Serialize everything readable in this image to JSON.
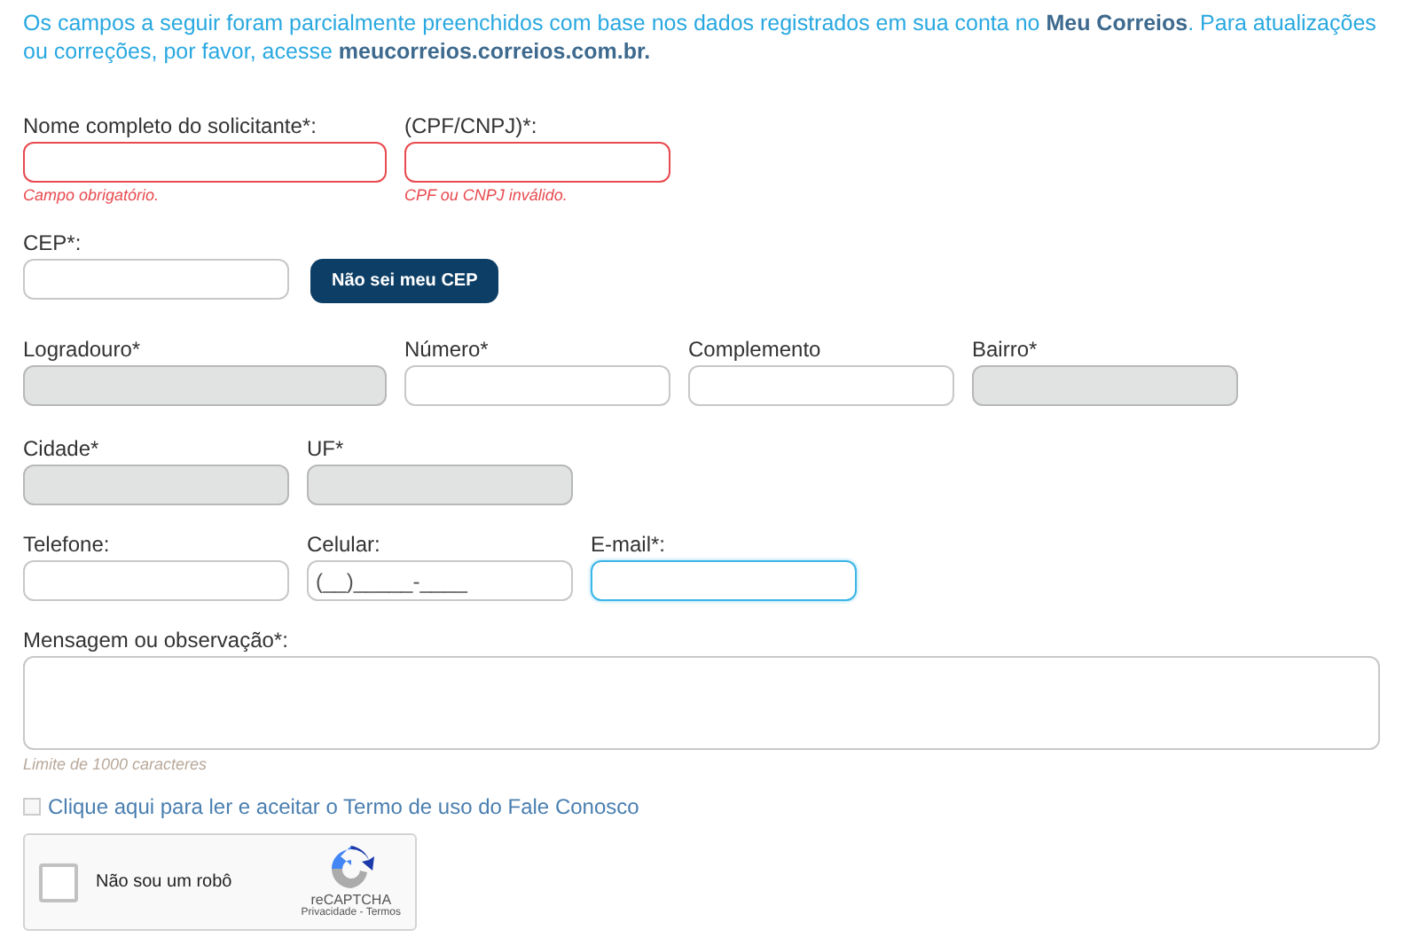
{
  "intro": "Os campos a seguir foram parcialmente preenchidos com base nos dados registrados em sua conta no **Meu Correios**. Para atualizações ou correções, por favor, acesse **meucorreios.correios.com.br.**",
  "rows": [
    {
      "fields": [
        {
          "label": "Nome completo do solicitante*:",
          "invalid": true,
          "readonly": false,
          "focused": false,
          "error": "Campo obrigatório."
        },
        {
          "label": "(CPF/CNPJ)*:",
          "invalid": true,
          "readonly": false,
          "focused": false,
          "error": "CPF ou CNPJ inválido."
        }
      ]
    },
    {
      "fields": [
        {
          "label": "CEP*:",
          "invalid": false,
          "readonly": false,
          "focused": false
        }
      ],
      "button": "Não sei meu CEP"
    },
    {
      "fields": [
        {
          "label": "Logradouro*",
          "invalid": false,
          "readonly": true,
          "focused": false
        },
        {
          "label": "Número*",
          "invalid": false,
          "readonly": false,
          "focused": false
        },
        {
          "label": "Complemento",
          "invalid": false,
          "readonly": false,
          "focused": false
        },
        {
          "label": "Bairro*",
          "invalid": false,
          "readonly": true,
          "focused": false
        }
      ]
    },
    {
      "fields": [
        {
          "label": "Cidade*",
          "invalid": false,
          "readonly": true,
          "focused": false
        },
        {
          "label": "UF*",
          "invalid": false,
          "readonly": true,
          "focused": false
        }
      ]
    },
    {
      "fields": [
        {
          "label": "Telefone:",
          "invalid": false,
          "readonly": false,
          "focused": false
        },
        {
          "label": "Celular:",
          "invalid": false,
          "readonly": false,
          "focused": false,
          "value": "(__)_____-____"
        },
        {
          "label": "E-mail*:",
          "invalid": false,
          "readonly": false,
          "focused": true
        }
      ]
    }
  ],
  "message": {
    "label": "Mensagem ou observação*:",
    "hint": "Limite de 1000 caracteres"
  },
  "terms": {
    "label": "Clique aqui para ler e aceitar o Termo de uso do Fale Conosco",
    "checked": false
  },
  "captcha": {
    "label": "Não sou um robô",
    "checked": false,
    "brand": "reCAPTCHA",
    "links": "Privacidade - Termos"
  }
}
